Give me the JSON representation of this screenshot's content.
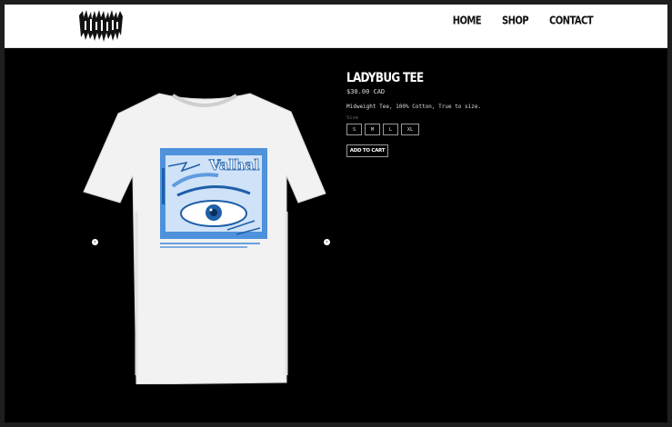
{
  "header": {
    "logo_icon": "band-logo-icon",
    "nav": [
      {
        "label": "HOME"
      },
      {
        "label": "SHOP"
      },
      {
        "label": "CONTACT"
      }
    ]
  },
  "product": {
    "title": "LADYBUG TEE",
    "price": "$30.00 CAD",
    "description": "Midweight Tee, 100% Cotton, True to size.",
    "size_label": "Size",
    "sizes": [
      "S",
      "M",
      "L",
      "XL"
    ],
    "add_to_cart": "ADD TO CART",
    "print_text": "Valhal"
  },
  "gallery": {
    "prev_icon": "chevron-left-icon",
    "next_icon": "chevron-right-icon",
    "prev_glyph": "‹",
    "next_glyph": "›"
  },
  "colors": {
    "accent_print": "#2f7fd6",
    "background": "#000000",
    "header_bg": "#ffffff"
  }
}
